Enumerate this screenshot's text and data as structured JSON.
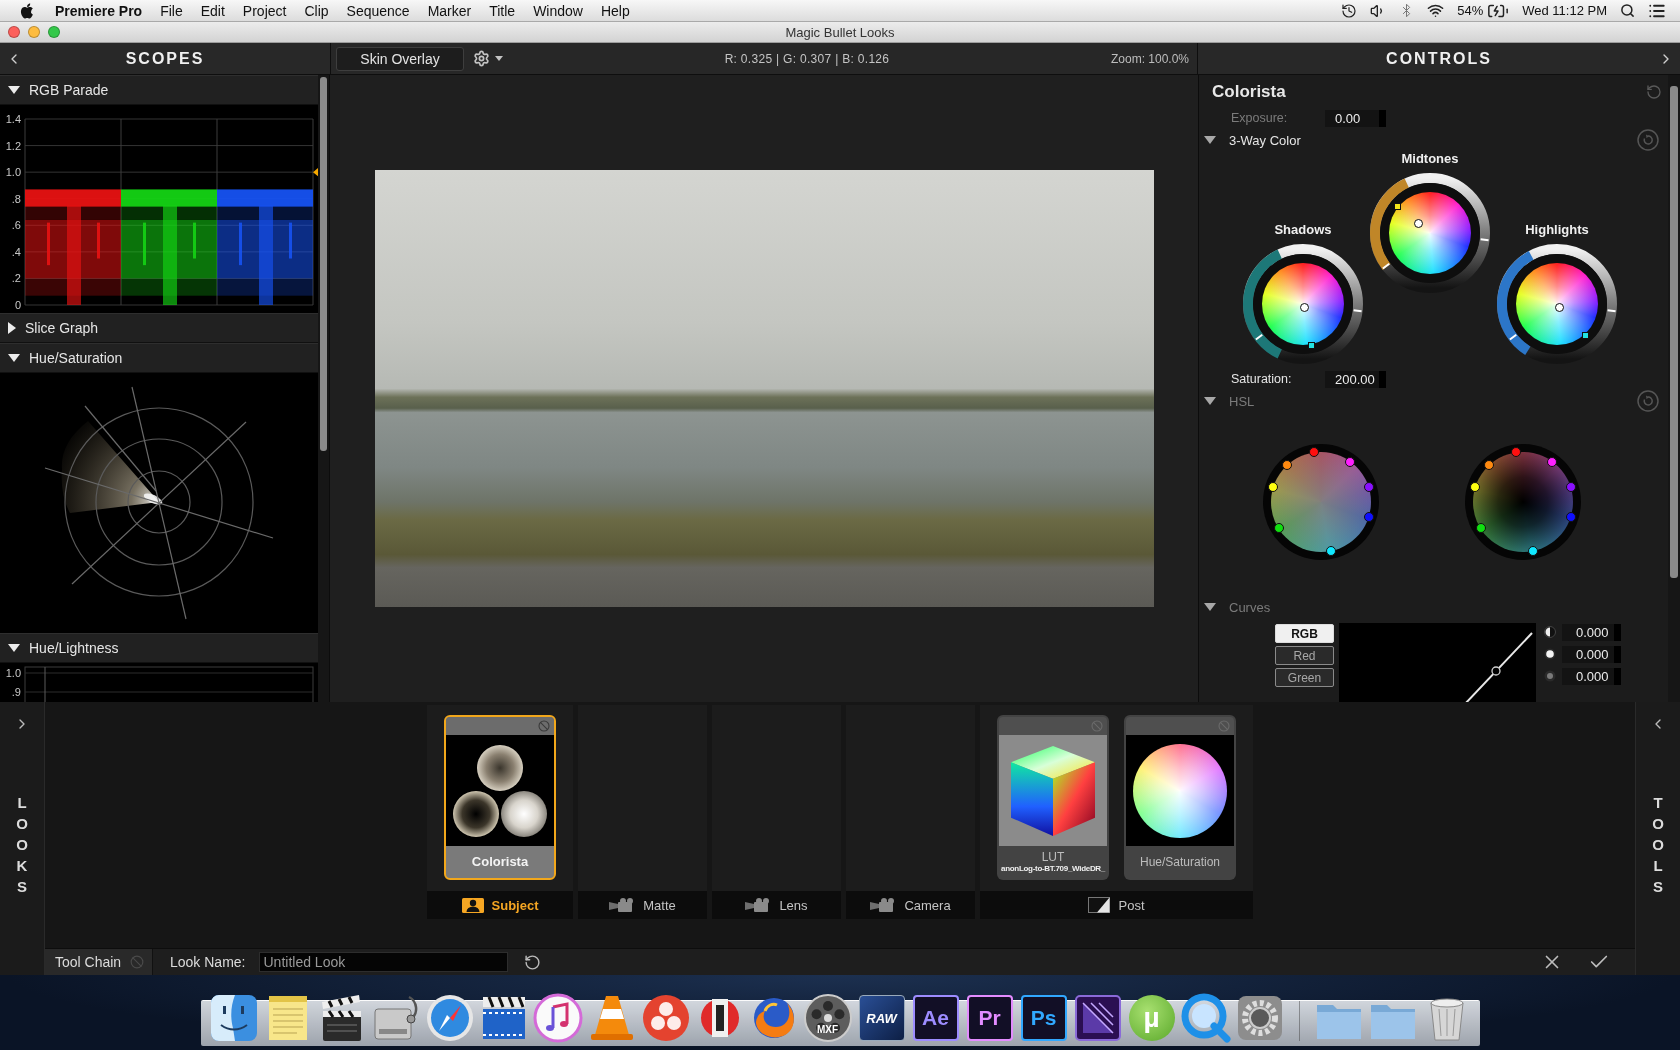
{
  "menu_bar": {
    "app_name": "Premiere Pro",
    "menus": [
      "File",
      "Edit",
      "Project",
      "Clip",
      "Sequence",
      "Marker",
      "Title",
      "Window",
      "Help"
    ],
    "battery": "54%",
    "clock": "Wed 11:12 PM"
  },
  "window": {
    "title": "Magic Bullet Looks"
  },
  "header": {
    "scopes_title": "SCOPES",
    "overlay_button": "Skin Overlay",
    "readout": "R: 0.325 | G: 0.307 | B: 0.126",
    "zoom": "Zoom: 100.0%",
    "controls_title": "CONTROLS"
  },
  "scopes": [
    {
      "kind": "parade",
      "title": "RGB Parade",
      "expanded": true,
      "ticks": [
        "1.4",
        "1.2",
        "1.0",
        ".8",
        ".6",
        ".4",
        ".2",
        "0"
      ]
    },
    {
      "title": "Slice Graph",
      "expanded": false
    },
    {
      "kind": "vectorscope",
      "title": "Hue/Saturation",
      "expanded": true
    },
    {
      "kind": "hue_lightness",
      "title": "Hue/Lightness",
      "expanded": true,
      "ticks": [
        "1.0",
        ".9"
      ]
    }
  ],
  "controls": {
    "tool": "Colorista",
    "exposure": {
      "label": "Exposure:",
      "value": "0.00",
      "active": false
    },
    "sections": [
      {
        "kind": "three_way",
        "title": "3-Way Color",
        "expanded": true,
        "active": true,
        "wheels": [
          {
            "label": "Shadows",
            "color": "#1d7878"
          },
          {
            "label": "Midtones",
            "color": "#c08628"
          },
          {
            "label": "Highlights",
            "color": "#2c76c8"
          }
        ],
        "saturation": {
          "label": "Saturation:",
          "value": "200.00",
          "active": true
        }
      },
      {
        "kind": "hsl",
        "title": "HSL",
        "expanded": true,
        "active": false,
        "wheels": [
          {
            "kind": "gray",
            "points": [
              {
                "color": "#ff1010"
              },
              {
                "color": "#ff20ff"
              },
              {
                "color": "#8a10ff"
              },
              {
                "color": "#1010ff"
              },
              {
                "color": "#10e8ff"
              },
              {
                "color": "#10e010"
              },
              {
                "color": "#ffff10"
              },
              {
                "color": "#ff8a10"
              }
            ]
          },
          {
            "kind": "dark",
            "points": [
              {
                "color": "#ff1010"
              },
              {
                "color": "#ff20ff"
              },
              {
                "color": "#8a10ff"
              },
              {
                "color": "#1010ff"
              },
              {
                "color": "#10e8ff"
              },
              {
                "color": "#10e010"
              },
              {
                "color": "#ffff10"
              },
              {
                "color": "#ff8a10"
              }
            ]
          }
        ]
      },
      {
        "kind": "curves",
        "title": "Curves",
        "expanded": true,
        "active": false,
        "channels": [
          {
            "label": "RGB",
            "selected": true
          },
          {
            "label": "Red",
            "selected": false
          },
          {
            "label": "Green",
            "selected": false
          }
        ],
        "values": [
          {
            "kind": "half",
            "value": "0.000"
          },
          {
            "kind": "full",
            "value": "0.000"
          },
          {
            "kind": "dim",
            "value": "0.000"
          }
        ]
      }
    ]
  },
  "looks_rail": {
    "label": "LOOKS"
  },
  "tool_chain": [
    {
      "kind": "subject",
      "label": "Subject",
      "selected": true,
      "tools": [
        {
          "kind": "colorista",
          "name": "Colorista",
          "selected": true
        }
      ]
    },
    {
      "kind": "matte",
      "label": "Matte",
      "selected": false
    },
    {
      "kind": "lens",
      "label": "Lens",
      "selected": false
    },
    {
      "kind": "camera",
      "label": "Camera",
      "selected": false
    },
    {
      "kind": "post",
      "label": "Post",
      "selected": false,
      "tools": [
        {
          "kind": "lut",
          "name": "LUT",
          "detail": "anonLog-to-BT.709_WideDR_",
          "selected": false
        },
        {
          "kind": "hue_saturation",
          "name": "Hue/Saturation",
          "selected": false
        }
      ]
    }
  ],
  "tools_rail": {
    "label": "TOOLS"
  },
  "bottom_bar": {
    "tool_chain_label": "Tool Chain",
    "look_name_label": "Look Name:",
    "look_name": "Untitled Look"
  },
  "dock": {
    "apps": [
      {
        "kind": "finder"
      },
      {
        "kind": "notes"
      },
      {
        "kind": "clapper"
      },
      {
        "kind": "drive"
      },
      {
        "kind": "compass"
      },
      {
        "kind": "film"
      },
      {
        "kind": "music"
      },
      {
        "kind": "cone"
      },
      {
        "kind": "circles"
      },
      {
        "kind": "capsule"
      },
      {
        "kind": "fox"
      },
      {
        "kind": "reel",
        "label": "MXF"
      },
      {
        "kind": "raw",
        "label": "RAW"
      },
      {
        "kind": "tile",
        "label": "Ae",
        "color": "#9d8cff"
      },
      {
        "kind": "tile",
        "label": "Pr",
        "color": "#e38cff"
      },
      {
        "kind": "tile",
        "label": "Ps",
        "color": "#31a8ff"
      },
      {
        "kind": "encoder"
      },
      {
        "kind": "letter",
        "label": "µ"
      },
      {
        "kind": "quick"
      },
      {
        "kind": "gear"
      }
    ],
    "stacks": [
      {
        "kind": "folder"
      },
      {
        "kind": "folder"
      },
      {
        "kind": "trash"
      }
    ]
  }
}
